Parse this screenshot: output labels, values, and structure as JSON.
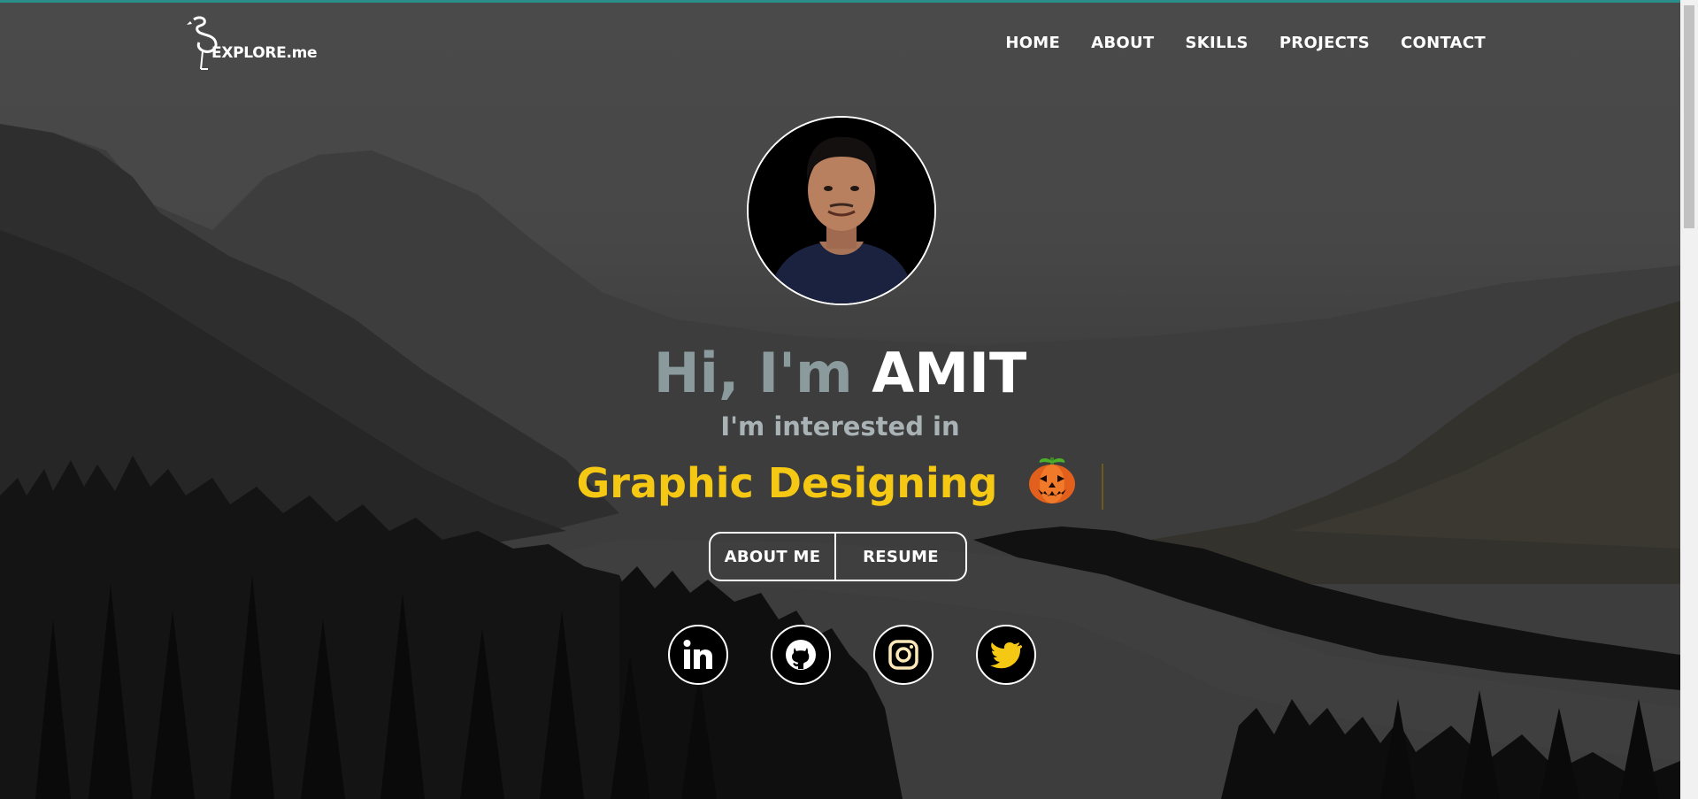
{
  "logo": {
    "text": "EXPLORE.me"
  },
  "nav": {
    "items": [
      {
        "label": "HOME"
      },
      {
        "label": "ABOUT"
      },
      {
        "label": "SKILLS"
      },
      {
        "label": "PROJECTS"
      },
      {
        "label": "CONTACT"
      }
    ]
  },
  "hero": {
    "greeting": "Hi, I'm",
    "name": "AMIT",
    "interested": "I'm interested in",
    "typed": "Graphic Designing",
    "emoji_icon": "pumpkin-icon"
  },
  "buttons": {
    "about_label": "ABOUT ME",
    "resume_label": "RESUME"
  },
  "socials": [
    {
      "icon": "linkedin-icon"
    },
    {
      "icon": "github-icon"
    },
    {
      "icon": "instagram-icon"
    },
    {
      "icon": "twitter-icon"
    }
  ],
  "colors": {
    "accent": "#f5c814",
    "greeting": "#8b9a9d",
    "topline": "#2a8f8a"
  }
}
